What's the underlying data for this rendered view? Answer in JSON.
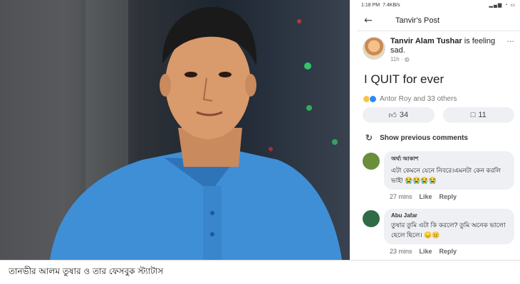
{
  "status_bar": {
    "time": "1:18 PM",
    "speed": "7.4KB/s",
    "right_icons": "signal wifi battery"
  },
  "top_bar": {
    "title": "Tanvir's Post"
  },
  "post": {
    "author": "Tanvir Alam Tushar",
    "feeling": "is feeling sad.",
    "time": "11h",
    "audience_icon": "globe-icon",
    "text": "I QUIT for ever",
    "reactions_text": "Antor Roy and 33 others",
    "like_count": "34",
    "comment_count": "11"
  },
  "show_previous": "Show previous comments",
  "comments": [
    {
      "name": "অর্ঘ্য আকাশ",
      "text": "এটা কেমনে যেনে নিবরে।এমনটা কেন করলি ভাই! 😭😭😭😭",
      "time": "27 mins",
      "like": "Like",
      "reply": "Reply",
      "avatar_color": "#6b8e3a"
    },
    {
      "name": "Abu Jafar",
      "text": "তুষার তুমি এটা কি করলে? তুমি অনেক ভালো ছেলে ছিলে। 😞😐",
      "time": "23 mins",
      "like": "Like",
      "reply": "Reply",
      "avatar_color": "#2f6b45"
    }
  ],
  "caption": "তানভীর আলম তুষার ও তার ফেসবুক স্ট্যাটাস",
  "colors": {
    "accent_blue": "#2d88ff",
    "shirt_blue": "#3f8fd6"
  }
}
